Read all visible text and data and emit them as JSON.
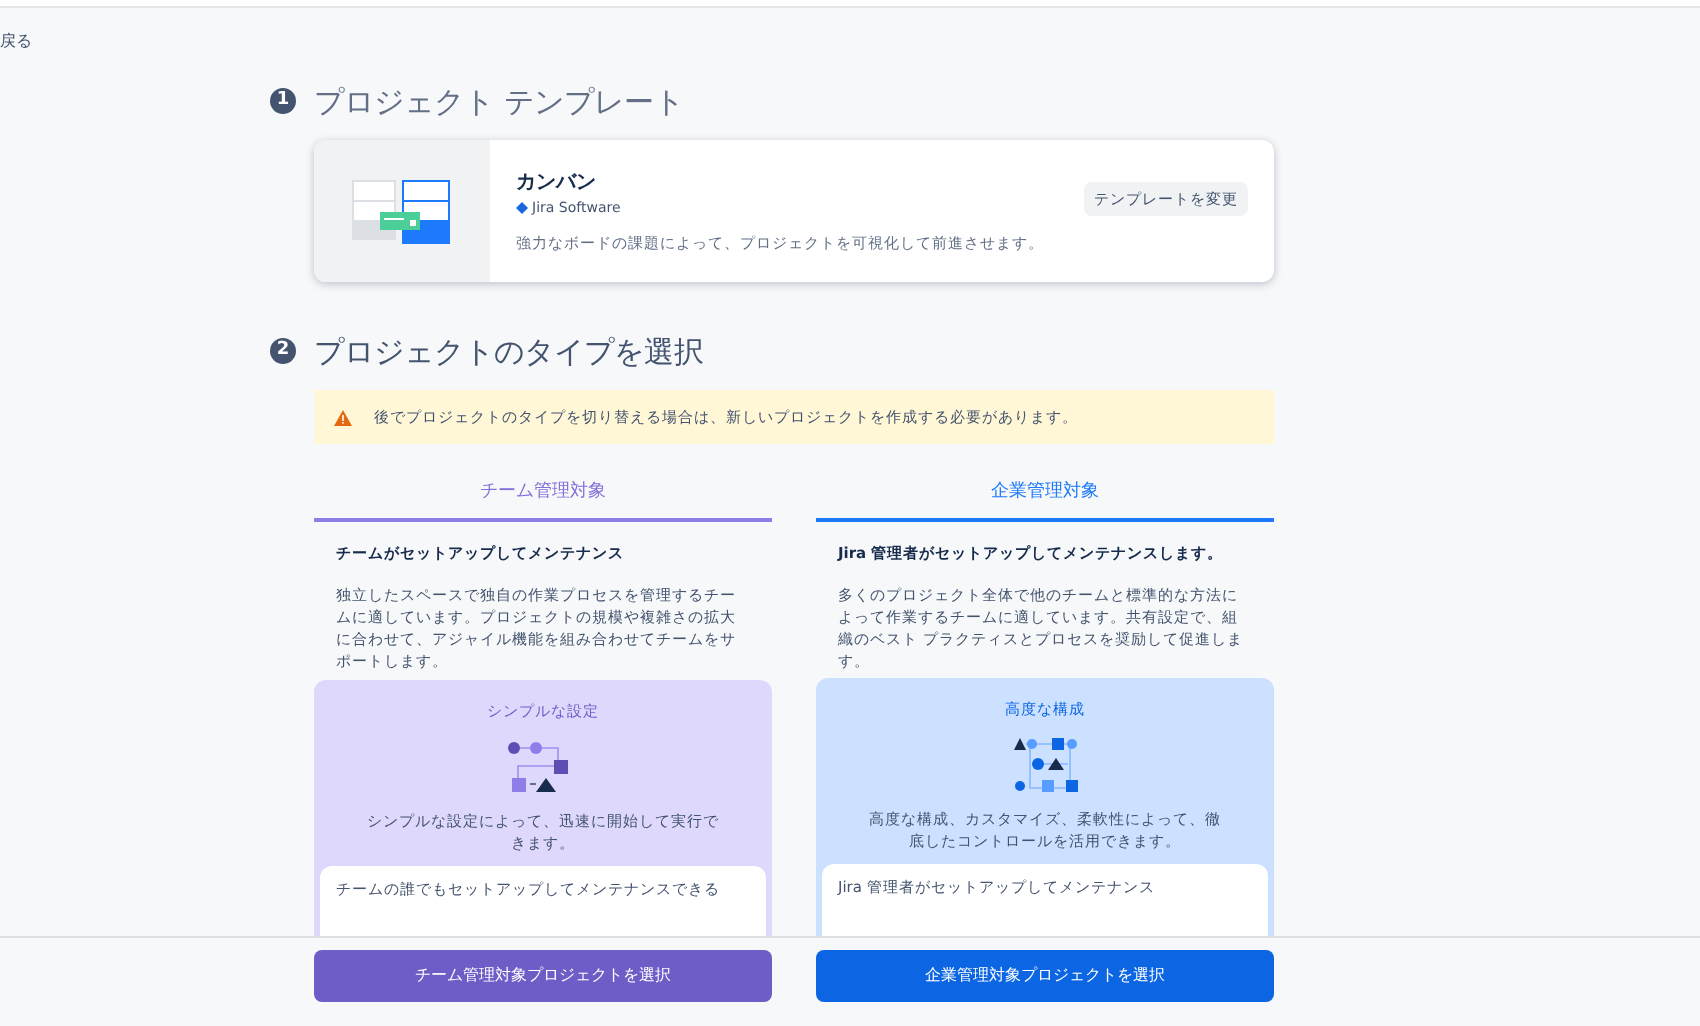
{
  "back_link": "戻る",
  "section_1": {
    "number": "1",
    "title": "プロジェクト テンプレート"
  },
  "template": {
    "name": "カンバン",
    "product": "Jira Software",
    "description": "強力なボードの課題によって、プロジェクトを可視化して前進させます。",
    "change_button": "テンプレートを変更"
  },
  "section_2": {
    "number": "2",
    "title": "プロジェクトのタイプを選択"
  },
  "warning": "後でプロジェクトのタイプを切り替える場合は、新しいプロジェクトを作成する必要があります。",
  "columns": [
    {
      "kind": "team",
      "heading": "チーム管理対象",
      "subtitle": "チームがセットアップしてメンテナンス",
      "description": "独立したスペースで独自の作業プロセスを管理するチームに適しています。プロジェクトの規模や複雑さの拡大に合わせて、アジャイル機能を組み合わせてチームをサポートします。",
      "panel_title": "シンプルな設定",
      "panel_text": "シンプルな設定によって、迅速に開始して実行できます。",
      "card_text": "チームの誰でもセットアップしてメンテナンスできる",
      "button": "チーム管理対象プロジェクトを選択"
    },
    {
      "kind": "company",
      "heading": "企業管理対象",
      "subtitle": "Jira 管理者がセットアップしてメンテナンスします。",
      "description": "多くのプロジェクト全体で他のチームと標準的な方法によって作業するチームに適しています。共有設定で、組織のベスト プラクティスとプロセスを奨励して促進します。",
      "panel_title": "高度な構成",
      "panel_text": "高度な構成、カスタマイズ、柔軟性によって、徹底したコントロールを活用できます。",
      "card_text": "Jira 管理者がセットアップしてメンテナンス",
      "button": "企業管理対象プロジェクトを選択"
    }
  ]
}
